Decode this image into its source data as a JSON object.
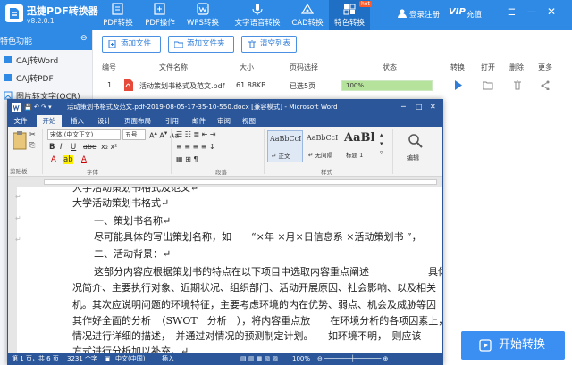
{
  "app": {
    "name": "迅捷PDF转换器",
    "version": "v8.2.0.1",
    "login_label": "登录注册",
    "vip_label": "VIP",
    "recharge_label": "充值",
    "brand_color": "#2f8ae6"
  },
  "top_tabs": [
    {
      "label": "PDF转换",
      "icon": "pdf-convert-icon"
    },
    {
      "label": "PDF操作",
      "icon": "pdf-operate-icon"
    },
    {
      "label": "WPS转换",
      "icon": "wps-icon"
    },
    {
      "label": "文字语音转换",
      "icon": "voice-icon"
    },
    {
      "label": "CAD转换",
      "icon": "cad-icon"
    },
    {
      "label": "特色转换",
      "icon": "special-icon",
      "badge": "hot"
    }
  ],
  "sidebar": {
    "header": "特色功能",
    "items": [
      {
        "label": "CAJ转Word"
      },
      {
        "label": "CAJ转PDF"
      },
      {
        "label": "图片转文字(OCR)"
      }
    ]
  },
  "toolbar": {
    "add_file": "添加文件",
    "add_folder": "添加文件夹",
    "clear_list": "清空列表"
  },
  "table": {
    "headers": [
      "编号",
      "文件名称",
      "大小",
      "页码选择",
      "状态",
      "转换",
      "打开",
      "删除",
      "更多"
    ],
    "rows": [
      {
        "index": "1",
        "name": "活动策划书格式及范文.pdf",
        "size": "61.88KB",
        "pages": "已选5页",
        "progress": "100%",
        "progress_value": 100
      }
    ]
  },
  "word": {
    "title": "活动策划书格式及范文.pdf-2019-08-05-17-35-10-550.docx [兼容模式] - Microsoft Word",
    "file_tab": "文件",
    "tabs": [
      "开始",
      "插入",
      "设计",
      "页面布局",
      "引用",
      "邮件",
      "审阅",
      "视图"
    ],
    "clipboard_label": "剪贴板",
    "font_label": "字体",
    "paragraph_label": "段落",
    "styles_label": "样式",
    "edit_label": "编辑",
    "font_name": "宋体 (中文正文)",
    "font_size": "五号",
    "styles": [
      {
        "preview": "AaBbCcI",
        "name": "↵ 正文"
      },
      {
        "preview": "AaBbCcI",
        "name": "↵ 无间隔"
      },
      {
        "preview": "AaBl",
        "name": "标题 1"
      }
    ],
    "doc_lines": [
      "大学活动策划书格式及范文↵",
      "大学活动策划书格式↵",
      "一、策划书名称↵",
      "尽可能具体的写出策划名称，如　　“×年 ×月×日信息系 ×活动策划书 ”，",
      "二、活动背景：↵",
      "这部分内容应根据策划书的特点在以下项目中选取内容重点阐述　　　　　　具体",
      "况简介、主要执行对象、近期状况、组织部门、活动开展原因、社会影响、以及相关",
      "机。其次应说明问题的环境特征，主要考虑环境的内在优势、弱点、机会及威胁等因",
      "其作好全面的分析　（SWOT　分析　），将内容重点放　　在环境分析的各项因素上，对",
      "情况进行详细的描述，　并通过对情况的预测制定计划。　　如环境不明，　则应该",
      "方式进行分析加以补充。↵"
    ],
    "status_page": "第 1 页，共 6 页",
    "status_words": "3231 个字",
    "status_lang": "中文(中国)",
    "status_mode": "插入",
    "zoom": "100%",
    "accent": "#2b579a"
  },
  "start_button": "开始转换"
}
